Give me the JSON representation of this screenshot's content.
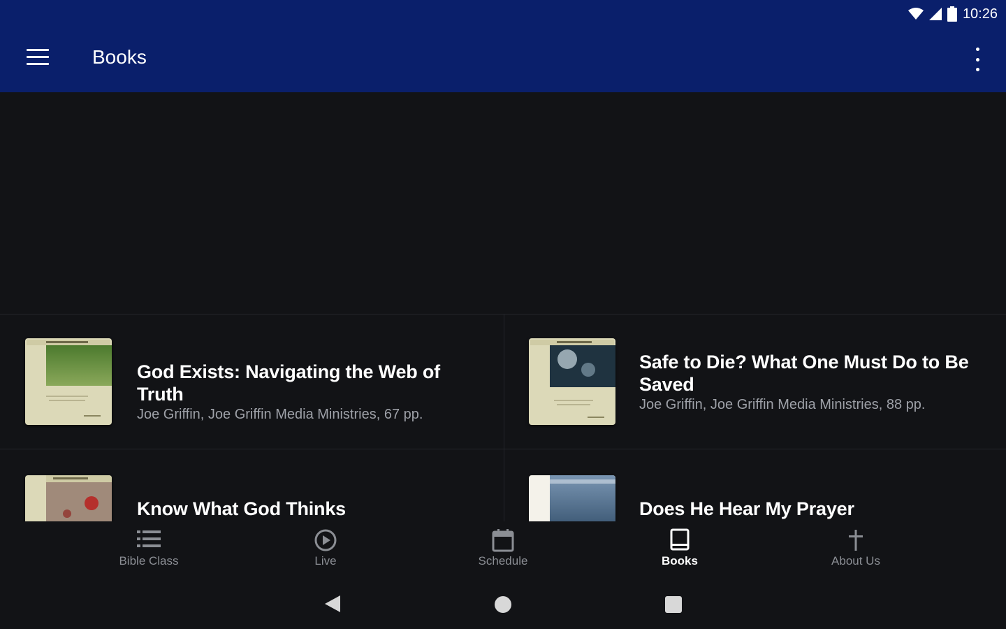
{
  "status_bar": {
    "time": "10:26",
    "icons": [
      "wifi-icon",
      "signal-icon",
      "battery-icon"
    ]
  },
  "app_bar": {
    "title": "Books",
    "menu_icon": "hamburger-menu-icon",
    "overflow_icon": "more-vert-icon",
    "color": "#0a1f6b"
  },
  "books": [
    {
      "title": "God Exists: Navigating the Web of Truth",
      "subtitle": "Joe Griffin, Joe Griffin Media Ministries, 67 pp."
    },
    {
      "title": "Safe to Die? What One Must Do to Be Saved",
      "subtitle": "Joe Griffin, Joe Griffin Media Ministries, 88 pp."
    },
    {
      "title": "Know What God Thinks",
      "subtitle": ""
    },
    {
      "title": "Does He Hear My Prayer",
      "subtitle": ""
    }
  ],
  "bottom_nav": {
    "items": [
      {
        "label": "Bible Class",
        "icon": "list-icon"
      },
      {
        "label": "Live",
        "icon": "play-circle-icon"
      },
      {
        "label": "Schedule",
        "icon": "calendar-icon"
      },
      {
        "label": "Books",
        "icon": "book-icon",
        "active": true
      },
      {
        "label": "About Us",
        "icon": "cross-icon"
      }
    ]
  },
  "system_nav": {
    "icons": [
      "back-icon",
      "home-icon",
      "recents-icon"
    ]
  }
}
